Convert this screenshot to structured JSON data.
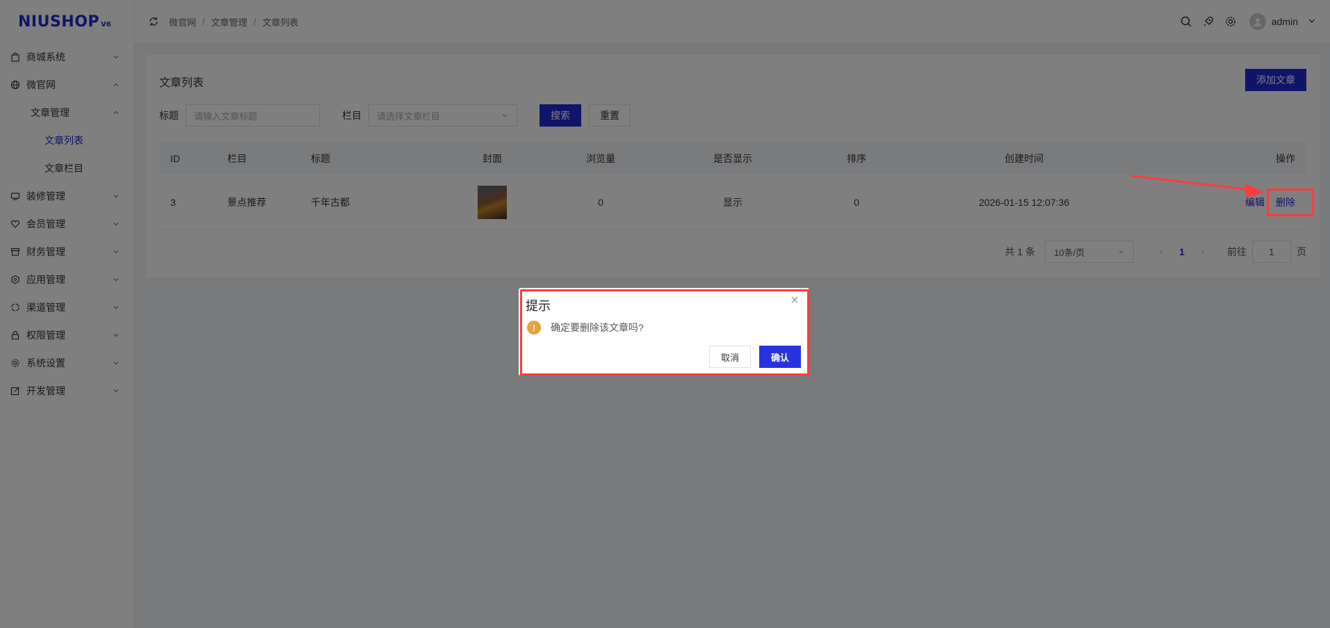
{
  "logo": {
    "text": "NIUSHOP",
    "version": "V6"
  },
  "sidebar": {
    "items": [
      {
        "label": "商城系统",
        "icon": "bag-icon",
        "expanded": false
      },
      {
        "label": "微官网",
        "icon": "globe-icon",
        "expanded": true
      },
      {
        "label": "文章管理",
        "level": 1,
        "expanded": true
      },
      {
        "label": "文章列表",
        "level": 2,
        "active": true
      },
      {
        "label": "文章栏目",
        "level": 2
      },
      {
        "label": "装修管理",
        "icon": "decor-icon",
        "expanded": false
      },
      {
        "label": "会员管理",
        "icon": "member-icon",
        "expanded": false
      },
      {
        "label": "财务管理",
        "icon": "finance-icon",
        "expanded": false
      },
      {
        "label": "应用管理",
        "icon": "app-icon",
        "expanded": false
      },
      {
        "label": "渠道管理",
        "icon": "channel-icon",
        "expanded": false
      },
      {
        "label": "权限管理",
        "icon": "lock-icon",
        "expanded": false
      },
      {
        "label": "系统设置",
        "icon": "gear-icon",
        "expanded": false
      },
      {
        "label": "开发管理",
        "icon": "edit-icon",
        "expanded": false
      }
    ]
  },
  "header": {
    "breadcrumb": [
      "微官网",
      "文章管理",
      "文章列表"
    ],
    "user": "admin"
  },
  "page": {
    "title": "文章列表",
    "add_button": "添加文章",
    "filters": {
      "title_label": "标题",
      "title_placeholder": "请输入文章标题",
      "category_label": "栏目",
      "category_placeholder": "请选择文章栏目",
      "search_button": "搜索",
      "reset_button": "重置"
    },
    "table": {
      "headers": [
        "ID",
        "栏目",
        "标题",
        "封面",
        "浏览量",
        "是否显示",
        "排序",
        "创建时间",
        "操作"
      ],
      "rows": [
        {
          "id": "3",
          "category": "景点推荐",
          "title": "千年古都",
          "views": "0",
          "show": "显示",
          "sort": "0",
          "created": "2026-01-15 12:07:36",
          "edit": "编辑",
          "delete": "删除"
        }
      ]
    },
    "pager": {
      "total": "共 1 条",
      "page_size": "10条/页",
      "current": "1",
      "goto_label": "前往",
      "goto_value": "1",
      "page_suffix": "页"
    }
  },
  "dialog": {
    "title": "提示",
    "message": "确定要删除该文章吗?",
    "cancel": "取消",
    "confirm": "确认"
  },
  "colors": {
    "primary": "#1f2bd1",
    "warning": "#e6a23c",
    "highlight": "#ff3b3b"
  }
}
